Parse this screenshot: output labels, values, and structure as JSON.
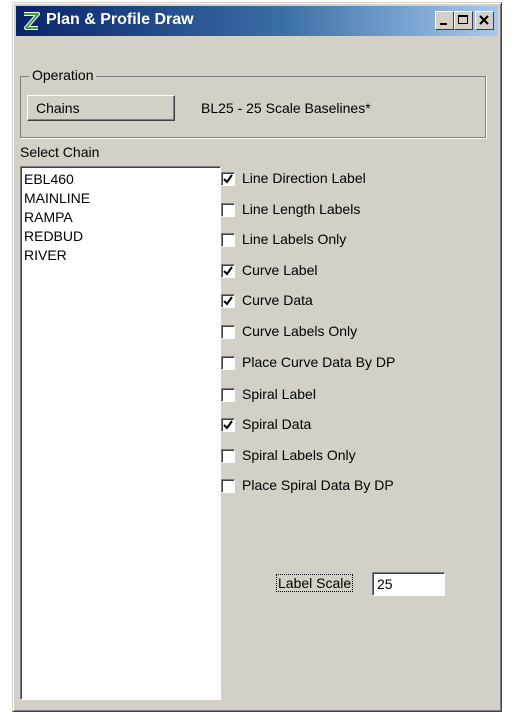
{
  "window": {
    "title": "Plan & Profile Draw"
  },
  "operation": {
    "legend": "Operation",
    "chains_button": "Chains",
    "baseline_text": "BL25 - 25 Scale Baselines*"
  },
  "chain_list": {
    "label": "Select Chain",
    "items": [
      "EBL460",
      "MAINLINE",
      "RAMPA",
      "REDBUD",
      "RIVER"
    ]
  },
  "options": [
    {
      "label": "Line Direction Label",
      "checked": true
    },
    {
      "label": "Line Length Labels",
      "checked": false
    },
    {
      "label": "Line Labels Only",
      "checked": false
    },
    {
      "label": "Curve Label",
      "checked": true
    },
    {
      "label": "Curve Data",
      "checked": true
    },
    {
      "label": "Curve Labels Only",
      "checked": false
    },
    {
      "label": "Place Curve Data By DP",
      "checked": false
    },
    {
      "label": "Spiral Label",
      "checked": false
    },
    {
      "label": "Spiral Data",
      "checked": true
    },
    {
      "label": "Spiral Labels Only",
      "checked": false
    },
    {
      "label": "Place Spiral Data By DP",
      "checked": false
    }
  ],
  "label_scale": {
    "label": "Label Scale",
    "value": "25"
  },
  "icons": {
    "app": "microstation-logo-icon",
    "minimize": "minimize-icon",
    "maximize": "maximize-icon",
    "close": "close-icon"
  }
}
